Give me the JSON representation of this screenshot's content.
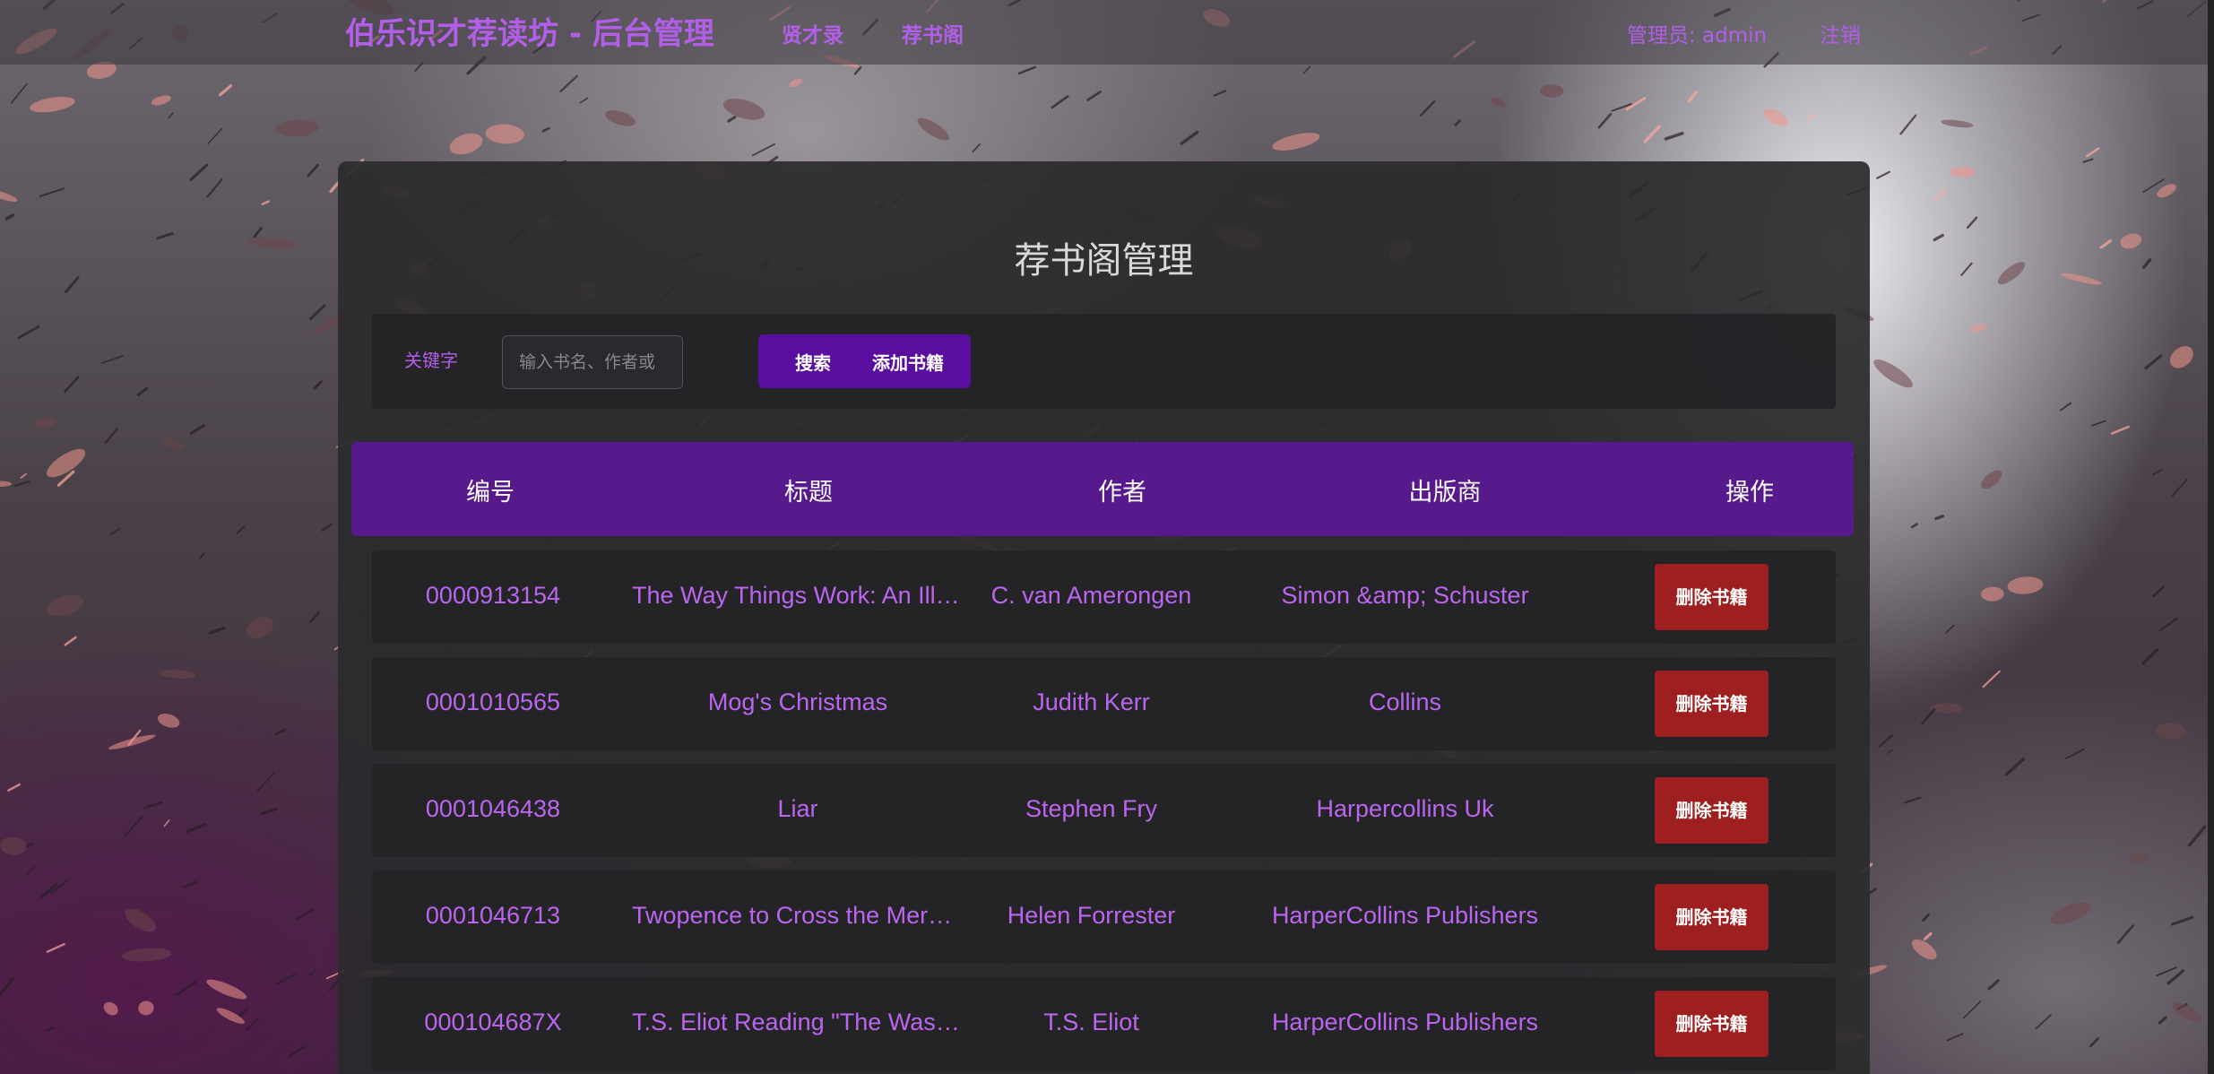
{
  "nav": {
    "brand": "伯乐识才荐读坊 - 后台管理",
    "links": [
      "贤才录",
      "荐书阁"
    ],
    "admin": "管理员: admin",
    "logout": "注销"
  },
  "panel": {
    "title": "荐书阁管理"
  },
  "search": {
    "label": "关键字",
    "placeholder": "输入书名、作者或",
    "search_label": "搜索",
    "add_label": "添加书籍"
  },
  "table": {
    "headers": [
      "编号",
      "标题",
      "作者",
      "出版商",
      "操作"
    ],
    "delete_label": "删除书籍",
    "rows": [
      {
        "id": "0000913154",
        "title": "The Way Things Work: An Illustrated Encyclopedia",
        "author": "C. van Amerongen",
        "publisher": "Simon &amp; Schuster"
      },
      {
        "id": "0001010565",
        "title": "Mog's Christmas",
        "author": "Judith Kerr",
        "publisher": "Collins"
      },
      {
        "id": "0001046438",
        "title": "Liar",
        "author": "Stephen Fry",
        "publisher": "Harpercollins Uk"
      },
      {
        "id": "0001046713",
        "title": "Twopence to Cross the Mersey",
        "author": "Helen Forrester",
        "publisher": "HarperCollins Publishers"
      },
      {
        "id": "000104687X",
        "title": "T.S. Eliot Reading \"The Waste Land\"",
        "author": "T.S. Eliot",
        "publisher": "HarperCollins Publishers"
      }
    ]
  },
  "colors": {
    "accent": "#b35ee8",
    "header_bg": "#561a8c",
    "button_group": "#5a0ea0",
    "delete_button": "#9e1f1f"
  }
}
